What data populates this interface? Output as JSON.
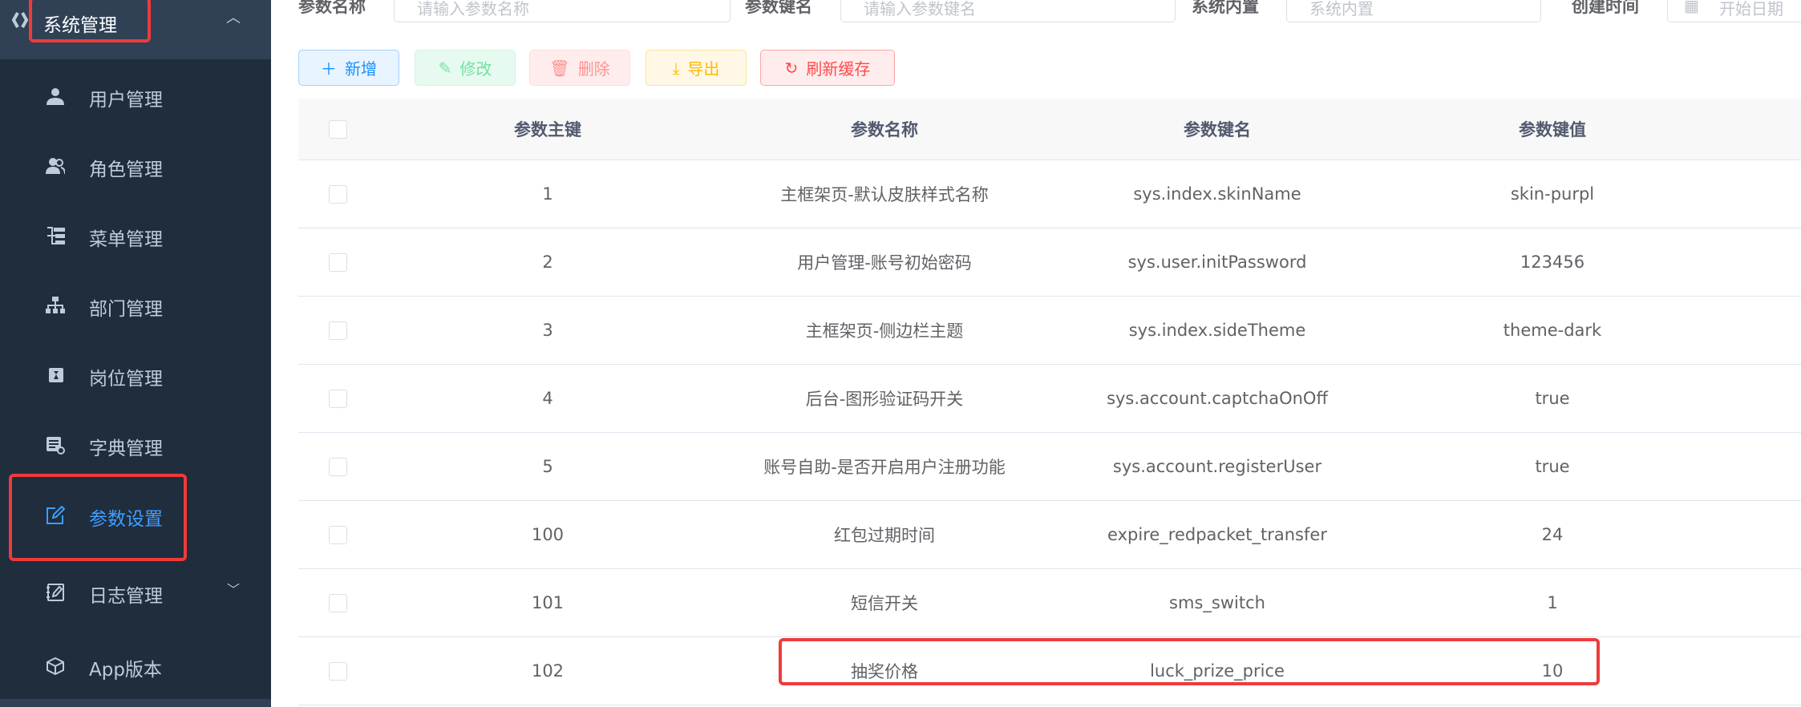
{
  "sidebar": {
    "group": "系统管理",
    "items": [
      {
        "label": "用户管理",
        "icon": "user-icon"
      },
      {
        "label": "角色管理",
        "icon": "peoples-icon"
      },
      {
        "label": "菜单管理",
        "icon": "tree-table-icon"
      },
      {
        "label": "部门管理",
        "icon": "tree-icon"
      },
      {
        "label": "岗位管理",
        "icon": "post-icon"
      },
      {
        "label": "字典管理",
        "icon": "dict-icon"
      },
      {
        "label": "参数设置",
        "icon": "edit-icon",
        "active": true
      },
      {
        "label": "日志管理",
        "icon": "log-icon",
        "expandable": true
      },
      {
        "label": "App版本",
        "icon": "cube-icon"
      }
    ]
  },
  "filters": {
    "config_name_label": "参数名称",
    "config_name_placeholder": "请输入参数名称",
    "config_key_label": "参数键名",
    "config_key_placeholder": "请输入参数键名",
    "config_type_label": "系统内置",
    "config_type_placeholder": "系统内置",
    "create_time_label": "创建时间",
    "start_date_placeholder": "开始日期"
  },
  "toolbar": {
    "add": "新增",
    "edit": "修改",
    "delete": "删除",
    "export": "导出",
    "refresh_cache": "刷新缓存"
  },
  "colors": {
    "accent": "#409eff",
    "sidebar_bg": "#1f2d3d",
    "highlight": "#ef3b3b"
  },
  "table": {
    "headers": [
      "参数主键",
      "参数名称",
      "参数键名",
      "参数键值"
    ],
    "rows": [
      [
        "1",
        "主框架页-默认皮肤样式名称",
        "sys.index.skinName",
        "skin-purpl"
      ],
      [
        "2",
        "用户管理-账号初始密码",
        "sys.user.initPassword",
        "123456"
      ],
      [
        "3",
        "主框架页-侧边栏主题",
        "sys.index.sideTheme",
        "theme-dark"
      ],
      [
        "4",
        "后台-图形验证码开关",
        "sys.account.captchaOnOff",
        "true"
      ],
      [
        "5",
        "账号自助-是否开启用户注册功能",
        "sys.account.registerUser",
        "true"
      ],
      [
        "100",
        "红包过期时间",
        "expire_redpacket_transfer",
        "24"
      ],
      [
        "101",
        "短信开关",
        "sms_switch",
        "1"
      ],
      [
        "102",
        "抽奖价格",
        "luck_prize_price",
        "10"
      ]
    ]
  }
}
